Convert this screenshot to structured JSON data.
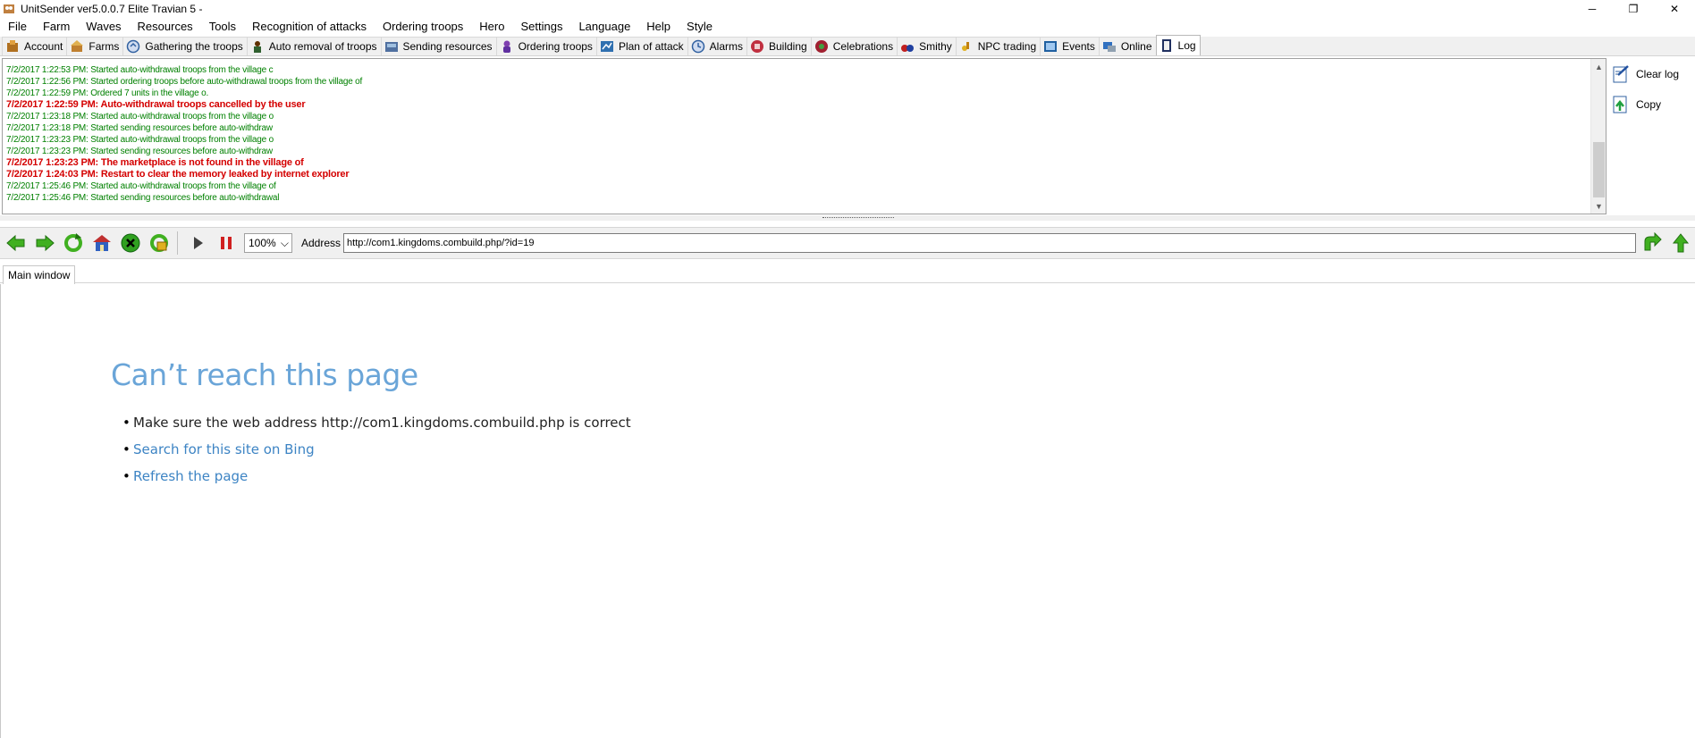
{
  "window": {
    "title": "UnitSender ver5.0.0.7 Elite Travian 5 -",
    "minimize": "─",
    "restore": "❐",
    "close": "✕"
  },
  "menu": [
    "File",
    "Farm",
    "Waves",
    "Resources",
    "Tools",
    "Recognition of attacks",
    "Ordering troops",
    "Hero",
    "Settings",
    "Language",
    "Help",
    "Style"
  ],
  "tabs": [
    {
      "label": "Account",
      "icon": "account-icon"
    },
    {
      "label": "Farms",
      "icon": "farms-icon"
    },
    {
      "label": "Gathering the troops",
      "icon": "gathering-icon"
    },
    {
      "label": "Auto removal of troops",
      "icon": "auto-removal-icon"
    },
    {
      "label": "Sending resources",
      "icon": "sending-resources-icon"
    },
    {
      "label": "Ordering troops",
      "icon": "ordering-troops-icon"
    },
    {
      "label": "Plan of attack",
      "icon": "plan-of-attack-icon"
    },
    {
      "label": "Alarms",
      "icon": "alarms-icon"
    },
    {
      "label": "Building",
      "icon": "building-icon"
    },
    {
      "label": "Celebrations",
      "icon": "celebrations-icon"
    },
    {
      "label": "Smithy",
      "icon": "smithy-icon"
    },
    {
      "label": "NPC trading",
      "icon": "npc-trading-icon"
    },
    {
      "label": "Events",
      "icon": "events-icon"
    },
    {
      "label": "Online",
      "icon": "online-icon"
    },
    {
      "label": "Log",
      "icon": "log-icon",
      "active": true
    }
  ],
  "log": {
    "lines": [
      {
        "text": "7/2/2017 1:22:53 PM: Started auto-withdrawal troops from the village c",
        "level": "info"
      },
      {
        "text": "7/2/2017 1:22:56 PM: Started ordering troops before auto-withdrawal troops from the village of",
        "level": "info"
      },
      {
        "text": "7/2/2017 1:22:59 PM: Ordered 7 units in the village o.",
        "level": "info"
      },
      {
        "text": "7/2/2017 1:22:59 PM: Auto-withdrawal troops cancelled by the user",
        "level": "error"
      },
      {
        "text": "7/2/2017 1:23:18 PM: Started auto-withdrawal troops from the village o",
        "level": "info"
      },
      {
        "text": "7/2/2017 1:23:18 PM: Started sending resources before auto-withdraw",
        "level": "info"
      },
      {
        "text": "7/2/2017 1:23:23 PM: Started auto-withdrawal troops from the village o",
        "level": "info"
      },
      {
        "text": "7/2/2017 1:23:23 PM: Started sending resources before auto-withdraw",
        "level": "info"
      },
      {
        "text": "7/2/2017 1:23:23 PM: The marketplace is not found in the village of",
        "level": "error"
      },
      {
        "text": "7/2/2017 1:24:03 PM: Restart to clear the memory leaked by internet explorer",
        "level": "error"
      },
      {
        "text": "7/2/2017 1:25:46 PM: Started auto-withdrawal troops from the village of",
        "level": "info"
      },
      {
        "text": "7/2/2017 1:25:46 PM: Started sending resources before auto-withdrawal",
        "level": "info"
      }
    ],
    "clear_label": "Clear log",
    "copy_label": "Copy"
  },
  "browser": {
    "zoom": "100%",
    "address_label": "Address",
    "address_value": "http://com1.kingdoms.combuild.php/?id=19",
    "doc_tab": "Main window"
  },
  "error_page": {
    "title": "Can’t reach this page",
    "item1": "Make sure the web address http://com1.kingdoms.combuild.php is correct",
    "item2": "Search for this site on Bing",
    "item3": "Refresh the page"
  },
  "colors": {
    "log_info": "#008000",
    "log_error": "#d40000",
    "error_title": "#6aa5d8",
    "link": "#3d84c4"
  }
}
